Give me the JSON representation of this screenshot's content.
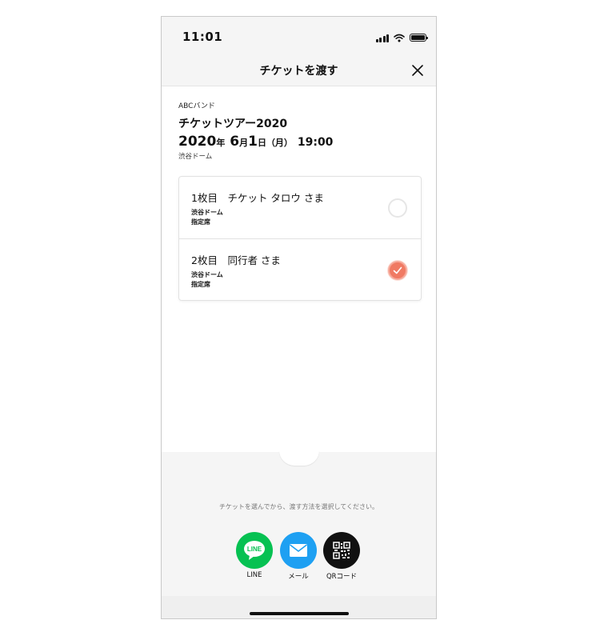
{
  "status_bar": {
    "time": "11:01"
  },
  "header": {
    "title": "チケットを渡す"
  },
  "event": {
    "artist": "ABCバンド",
    "title": "チケットツアー2020",
    "date": {
      "year": "2020",
      "year_unit": "年",
      "month": "6",
      "month_unit": "月",
      "day": "1",
      "day_unit": "日",
      "weekday": "（月）",
      "time": "19:00"
    },
    "venue": "渋谷ドーム"
  },
  "tickets": [
    {
      "name": "1枚目　チケット タロウ さま",
      "venue": "渋谷ドーム",
      "seat": "指定席",
      "selected": false
    },
    {
      "name": "2枚目　同行者 さま",
      "venue": "渋谷ドーム",
      "seat": "指定席",
      "selected": true
    }
  ],
  "footer": {
    "hint": "チケットを選んでから、渡す方法を選択してください。",
    "share": [
      {
        "label": "LINE",
        "icon": "line-icon",
        "color": "#06c152",
        "badge": "LINE"
      },
      {
        "label": "メール",
        "icon": "mail-icon",
        "color": "#1ea0f2"
      },
      {
        "label": "QRコード",
        "icon": "qr-code-icon",
        "color": "#111111"
      }
    ]
  },
  "colors": {
    "accent": "#f07a63",
    "background": "#f5f5f5"
  }
}
